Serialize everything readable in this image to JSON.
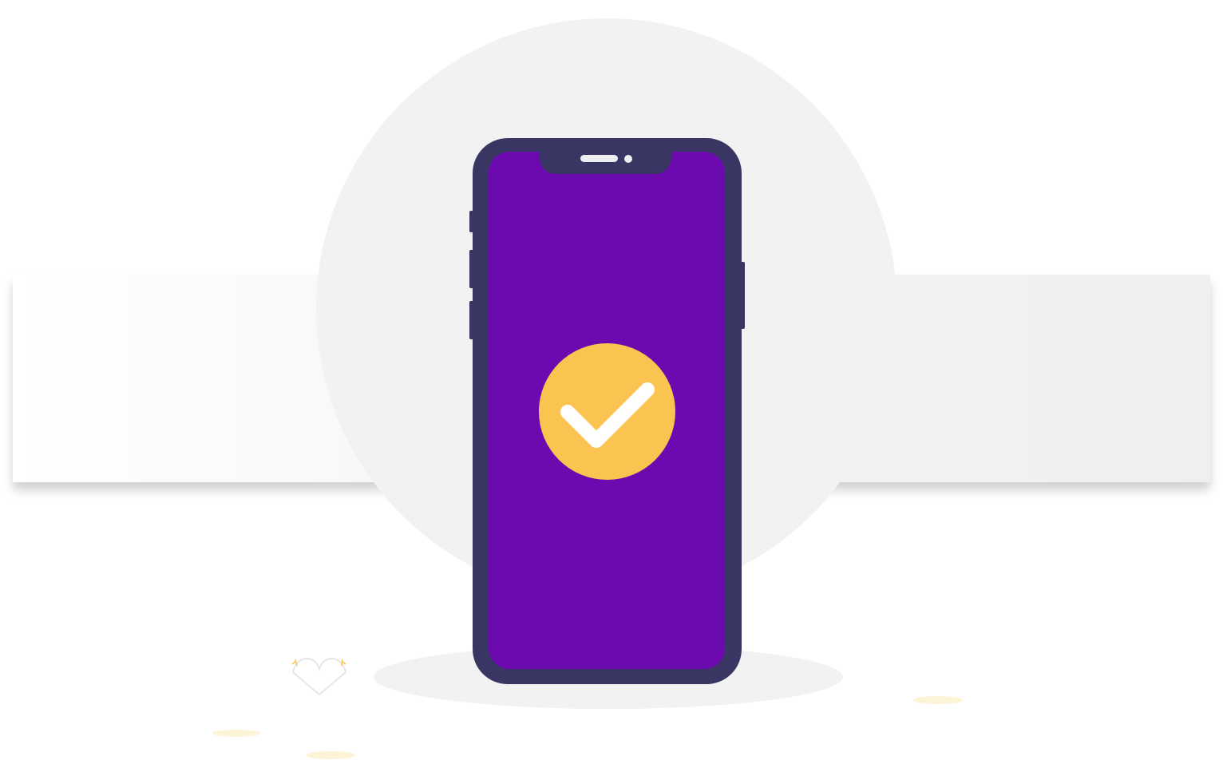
{
  "illustration": {
    "subject": "smartphone-with-checkmark",
    "colors": {
      "background": "#ffffff",
      "band": "#f3f3f3",
      "circle": "#f2f2f2",
      "phone_frame": "#3a3664",
      "phone_screen": "#6c0aaf",
      "check_badge": "#fbc350",
      "check_mark": "#ffffff",
      "accent_spots": "#fdf3d6"
    },
    "icons": [
      "smartphone-icon",
      "checkmark-icon",
      "speaker-icon",
      "camera-icon",
      "heart-outline-icon"
    ]
  }
}
